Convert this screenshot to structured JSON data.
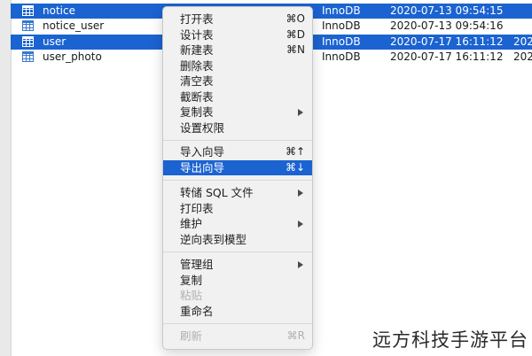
{
  "tables": [
    {
      "name": "notice",
      "engine": "InnoDB",
      "modified": "2020-07-13 09:54:15",
      "extra": "",
      "selected": true
    },
    {
      "name": "notice_user",
      "engine": "InnoDB",
      "modified": "2020-07-13 09:54:16",
      "extra": "",
      "selected": false
    },
    {
      "name": "user",
      "engine": "InnoDB",
      "modified": "2020-07-17 16:11:12",
      "extra": "202",
      "selected": true
    },
    {
      "name": "user_photo",
      "engine": "InnoDB",
      "modified": "2020-07-17 16:11:12",
      "extra": "202",
      "selected": false
    }
  ],
  "icons": {
    "table": "table-grid-icon",
    "submenu": "chevron-right-icon"
  },
  "colors": {
    "selection": "#1b63d1",
    "menu_background": "#f1f1f1",
    "disabled_text": "#b0b0b0"
  },
  "context_menu": {
    "groups": [
      {
        "items": [
          {
            "label": "打开表",
            "shortcut": "⌘O"
          },
          {
            "label": "设计表",
            "shortcut": "⌘D"
          },
          {
            "label": "新建表",
            "shortcut": "⌘N"
          },
          {
            "label": "删除表",
            "shortcut": ""
          },
          {
            "label": "清空表",
            "shortcut": ""
          },
          {
            "label": "截断表",
            "shortcut": ""
          },
          {
            "label": "复制表",
            "shortcut": "",
            "submenu": true
          },
          {
            "label": "设置权限",
            "shortcut": ""
          }
        ]
      },
      {
        "items": [
          {
            "label": "导入向导",
            "shortcut": "⌘↑"
          },
          {
            "label": "导出向导",
            "shortcut": "⌘↓",
            "highlighted": true
          }
        ]
      },
      {
        "items": [
          {
            "label": "转储 SQL 文件",
            "shortcut": "",
            "submenu": true
          },
          {
            "label": "打印表",
            "shortcut": ""
          },
          {
            "label": "维护",
            "shortcut": "",
            "submenu": true
          },
          {
            "label": "逆向表到模型",
            "shortcut": ""
          }
        ]
      },
      {
        "items": [
          {
            "label": "管理组",
            "shortcut": "",
            "submenu": true
          },
          {
            "label": "复制",
            "shortcut": ""
          },
          {
            "label": "粘贴",
            "shortcut": "",
            "disabled": true
          },
          {
            "label": "重命名",
            "shortcut": ""
          }
        ]
      },
      {
        "items": [
          {
            "label": "刷新",
            "shortcut": "⌘R",
            "disabled": true
          }
        ]
      }
    ]
  },
  "watermark": "远方科技手游平台"
}
